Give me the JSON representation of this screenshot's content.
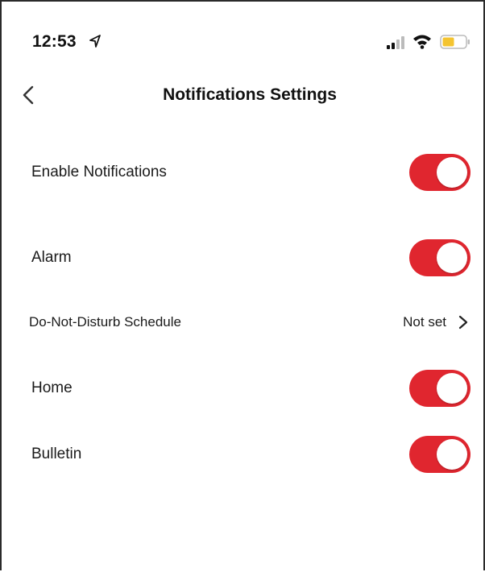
{
  "status_bar": {
    "time": "12:53",
    "icons": [
      "location-arrow-icon",
      "cellular-signal-icon",
      "wifi-icon",
      "battery-icon"
    ],
    "battery_color": "#f4c430"
  },
  "header": {
    "title": "Notifications Settings",
    "back_icon": "chevron-left-icon"
  },
  "settings": {
    "enable_notifications": {
      "label": "Enable Notifications",
      "enabled": true
    },
    "alarm": {
      "label": "Alarm",
      "enabled": true
    },
    "dnd_schedule": {
      "label": "Do-Not-Disturb Schedule",
      "value": "Not set"
    },
    "home": {
      "label": "Home",
      "enabled": true
    },
    "bulletin": {
      "label": "Bulletin",
      "enabled": true
    }
  },
  "colors": {
    "toggle_on": "#e0262f",
    "text": "#1a1a1a",
    "background": "#ffffff"
  }
}
